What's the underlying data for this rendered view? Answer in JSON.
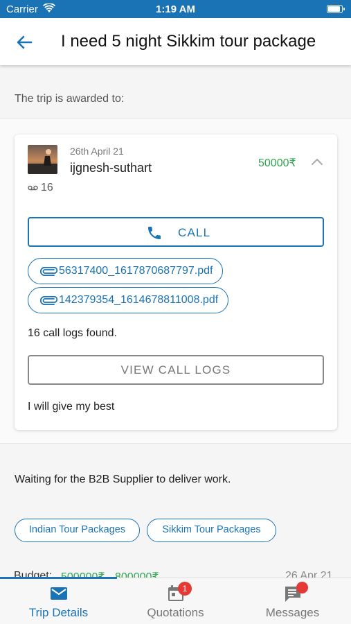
{
  "status_bar": {
    "carrier": "Carrier",
    "time": "1:19 AM"
  },
  "header": {
    "title": "I need 5 night Sikkim tour package"
  },
  "awarded_label": "The trip is awarded to:",
  "bid": {
    "date": "26th April 21",
    "supplier": "ijgnesh-suthart",
    "amount": "50000₹",
    "call_count": "16",
    "call_button": "CALL",
    "attachments": [
      "56317400_1617870687797.pdf",
      "142379354_1614678811008.pdf"
    ],
    "call_logs_text": "16 call logs found.",
    "view_logs_button": "VIEW CALL LOGS",
    "message": "I will give my best"
  },
  "status_message": "Waiting for the B2B Supplier to deliver work.",
  "tags": [
    "Indian Tour Packages",
    "Sikkim Tour Packages"
  ],
  "budget_peek": {
    "label": "Budget:",
    "min": "500000₹",
    "max": "800000₹",
    "date": "26 Apr 21"
  },
  "tabs": [
    {
      "label": "Trip Details",
      "icon": "envelope-icon",
      "active": true
    },
    {
      "label": "Quotations",
      "icon": "calendar-icon",
      "badge": "1"
    },
    {
      "label": "Messages",
      "icon": "chat-icon",
      "dot": true
    }
  ],
  "colors": {
    "primary": "#1a73b5",
    "amount_green": "#2ea44f",
    "badge_red": "#e53935"
  }
}
